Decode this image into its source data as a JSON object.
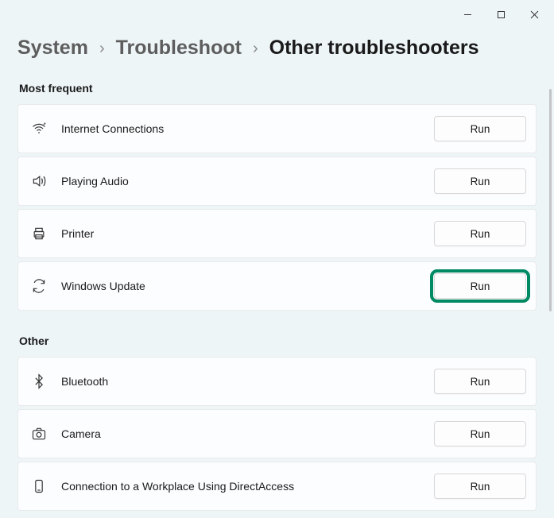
{
  "breadcrumb": {
    "system": "System",
    "troubleshoot": "Troubleshoot",
    "current": "Other troubleshooters"
  },
  "sections": {
    "most_frequent": {
      "title": "Most frequent",
      "items": [
        {
          "label": "Internet Connections",
          "button": "Run",
          "icon": "wifi-icon",
          "highlighted": false
        },
        {
          "label": "Playing Audio",
          "button": "Run",
          "icon": "speaker-icon",
          "highlighted": false
        },
        {
          "label": "Printer",
          "button": "Run",
          "icon": "printer-icon",
          "highlighted": false
        },
        {
          "label": "Windows Update",
          "button": "Run",
          "icon": "sync-icon",
          "highlighted": true
        }
      ]
    },
    "other": {
      "title": "Other",
      "items": [
        {
          "label": "Bluetooth",
          "button": "Run",
          "icon": "bluetooth-icon",
          "highlighted": false
        },
        {
          "label": "Camera",
          "button": "Run",
          "icon": "camera-icon",
          "highlighted": false
        },
        {
          "label": "Connection to a Workplace Using DirectAccess",
          "button": "Run",
          "icon": "phone-icon",
          "highlighted": false
        }
      ]
    }
  },
  "run_label": "Run",
  "highlight_color": "#008a63"
}
